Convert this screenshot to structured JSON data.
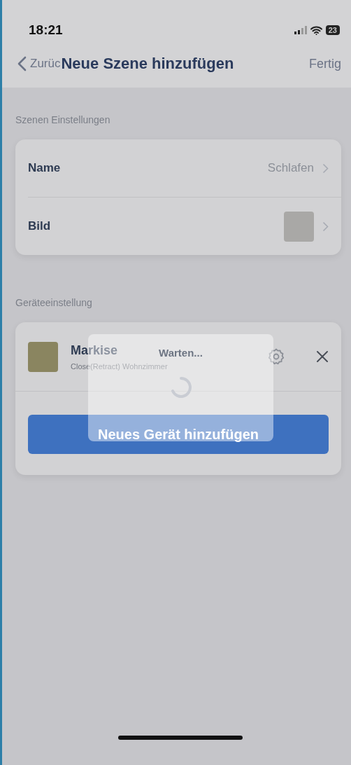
{
  "status_bar": {
    "time": "18:21",
    "battery": "23"
  },
  "nav": {
    "back_label": "Zurüc",
    "title": "Neue Szene hinzufügen",
    "done": "Fertig"
  },
  "scene_settings": {
    "header": "Szenen Einstellungen",
    "rows": [
      {
        "kind": "value",
        "label": "Name",
        "value": "Schlafen"
      },
      {
        "kind": "image",
        "label": "Bild"
      }
    ]
  },
  "device_settings": {
    "header": "Geräteeinstellung",
    "devices": [
      {
        "name": "Markise",
        "subtitle": "Close(Retract) Wohnzimmer"
      }
    ],
    "add_button": "Neues Gerät hinzufügen"
  },
  "loading": {
    "title": "Warten..."
  }
}
